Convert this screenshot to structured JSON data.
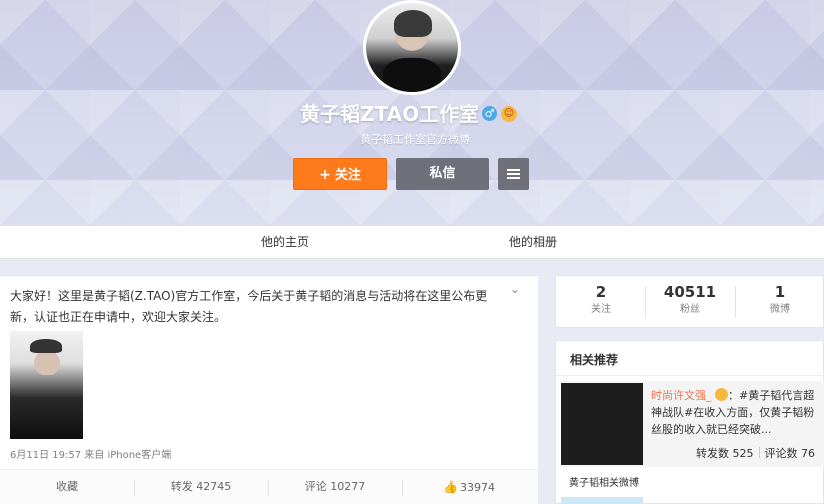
{
  "profile": {
    "name": "黄子韬ZTAO工作室",
    "subtitle": "黄子韬工作室官方微博",
    "gender_icon": "male-icon",
    "badge_icon": "emoji-badge-icon"
  },
  "actions": {
    "follow_label": "关注",
    "follow_plus": "+",
    "message_label": "私信"
  },
  "nav": {
    "home_tab": "他的主页",
    "album_tab": "他的相册"
  },
  "post": {
    "text": "大家好！这里是黄子韬(Z.TAO)官方工作室，今后关于黄子韬的消息与活动将在这里公布更新，认证也正在申请中，欢迎大家关注。",
    "meta": "6月11日 19:57 来自 iPhone客户端",
    "collect_label": "收藏",
    "repost_label": "转发 42745",
    "comment_label": "评论 10277",
    "like_count": "33974"
  },
  "stats": [
    {
      "value": "2",
      "label": "关注"
    },
    {
      "value": "40511",
      "label": "粉丝"
    },
    {
      "value": "1",
      "label": "微博"
    }
  ],
  "recommend": {
    "title": "相关推荐",
    "author": "时尚许文强_",
    "text": "：#黄子韬代言超神战队#在收入方面，仅黄子韬粉丝股的收入就已经突破...",
    "reposts": "转发数 525",
    "comments": "评论数 76",
    "footer": "黄子韬相关微博"
  },
  "colors": {
    "follow_button": "#ff7a1a",
    "message_button": "#6f7079",
    "author_link": "#eb7350"
  }
}
